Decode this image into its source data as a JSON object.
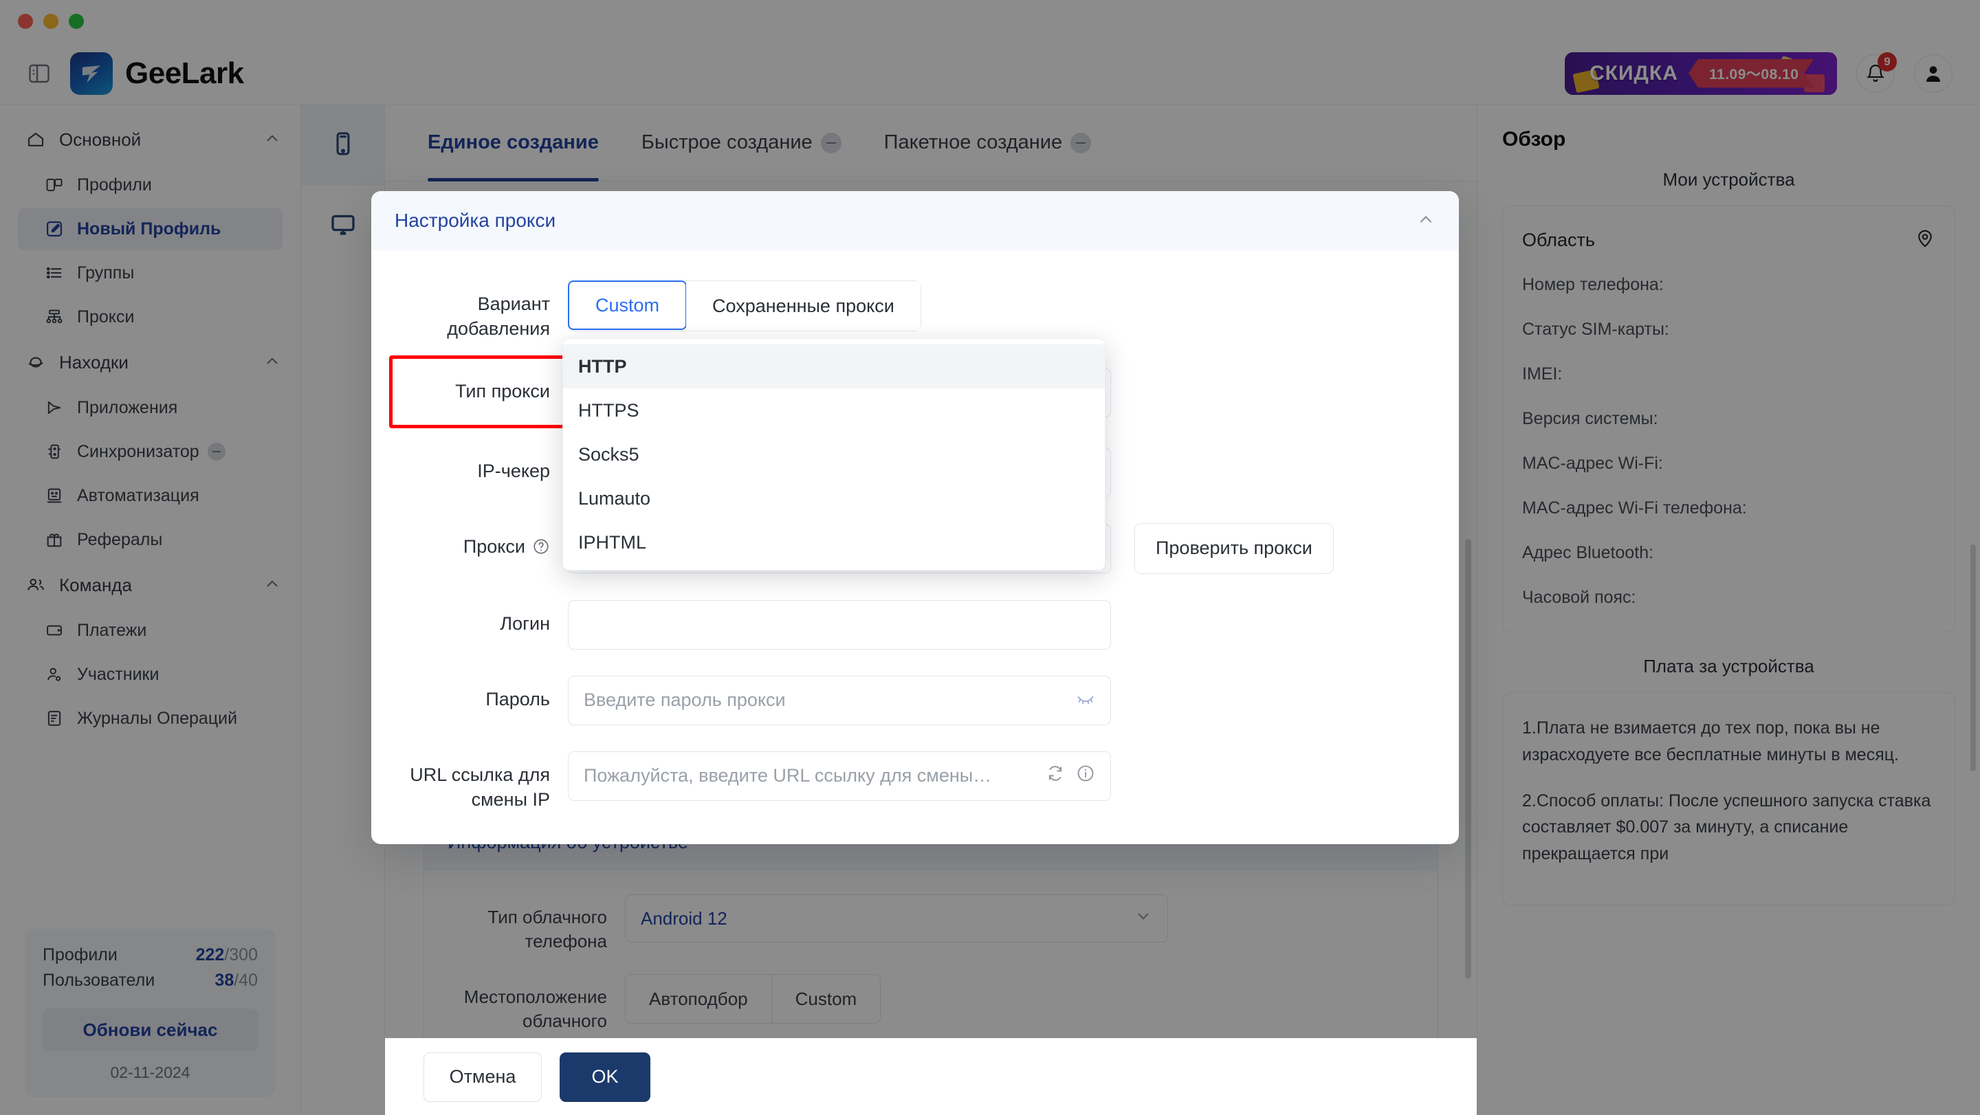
{
  "window": {
    "traffic_lights": [
      "close",
      "minimize",
      "maximize"
    ]
  },
  "header": {
    "brand_name": "GeeLark",
    "panel_toggle_icon": "panel-toggle-icon",
    "promo": {
      "word": "СКИДКА",
      "dates": "11.09～08.10"
    },
    "notifications_badge": "9",
    "bell_icon": "bell-icon",
    "avatar_icon": "avatar-icon"
  },
  "sidebar": {
    "groups": [
      {
        "label": "Основной",
        "icon": "home-icon",
        "items": [
          {
            "label": "Профили",
            "icon": "profiles-icon",
            "active": false
          },
          {
            "label": "Новый Профиль",
            "icon": "new-profile-icon",
            "active": true
          },
          {
            "label": "Группы",
            "icon": "groups-icon",
            "active": false
          },
          {
            "label": "Прокси",
            "icon": "proxy-icon",
            "active": false
          }
        ]
      },
      {
        "label": "Находки",
        "icon": "discover-icon",
        "items": [
          {
            "label": "Приложения",
            "icon": "apps-icon",
            "active": false
          },
          {
            "label": "Синхронизатор",
            "icon": "sync-icon",
            "active": false,
            "muted_tag": true
          },
          {
            "label": "Автоматизация",
            "icon": "automation-icon",
            "active": false
          },
          {
            "label": "Рефералы",
            "icon": "referrals-icon",
            "active": false
          }
        ]
      },
      {
        "label": "Команда",
        "icon": "team-icon",
        "items": [
          {
            "label": "Платежи",
            "icon": "payments-icon",
            "active": false
          },
          {
            "label": "Участники",
            "icon": "members-icon",
            "active": false
          },
          {
            "label": "Журналы Операций",
            "icon": "logs-icon",
            "active": false
          }
        ]
      }
    ],
    "stats": [
      {
        "label": "Профили",
        "used": "222",
        "total": "/300"
      },
      {
        "label": "Пользователи",
        "used": "38",
        "total": "/40"
      }
    ],
    "upgrade_label": "Обнови сейчас",
    "date": "02-11-2024"
  },
  "rail": {
    "items": [
      {
        "icon": "phone-icon",
        "active": true
      },
      {
        "icon": "monitor-icon",
        "active": false
      }
    ]
  },
  "main": {
    "tabs": [
      {
        "label": "Единое создание",
        "active": true,
        "has_pill": false
      },
      {
        "label": "Быстрое создание",
        "active": false,
        "has_pill": true
      },
      {
        "label": "Пакетное создание",
        "active": false,
        "has_pill": true
      }
    ],
    "device_section": {
      "title": "Информация об устройстве",
      "collapse_icon": "chevron-up-icon",
      "rows": [
        {
          "label": "Тип облачного телефона",
          "type": "select",
          "value": "Android 12"
        },
        {
          "label": "Местоположение облачного",
          "type": "segment",
          "options": [
            "Автоподбор",
            "Custom"
          ],
          "selected": "Автоподбор"
        }
      ]
    }
  },
  "modal": {
    "title": "Настройка прокси",
    "collapse_icon": "chevron-up-icon",
    "rows": {
      "add_variant": {
        "label": "Вариант добавления",
        "options": [
          "Custom",
          "Сохраненные прокси"
        ],
        "selected": "Custom"
      },
      "proxy_type": {
        "label": "Тип прокси",
        "value": "HTTP",
        "highlighted": true,
        "options": [
          "HTTP",
          "HTTPS",
          "Socks5",
          "Lumauto",
          "IPHTML"
        ],
        "selected_option": "HTTP"
      },
      "ip_checker": {
        "label": "IP-чекер"
      },
      "proxy": {
        "label": "Прокси",
        "help_icon": "help-circle-icon",
        "check_button": "Проверить прокси"
      },
      "login": {
        "label": "Логин"
      },
      "password": {
        "label": "Пароль",
        "placeholder": "Введите пароль прокси",
        "eye_icon": "eye-off-icon"
      },
      "ip_change_url": {
        "label": "URL ссылка для смены IP",
        "placeholder": "Пожалуйста, введите URL ссылку для смены IP...",
        "refresh_icon": "refresh-icon",
        "info_icon": "info-circle-icon"
      }
    }
  },
  "footer": {
    "cancel_label": "Отмена",
    "ok_label": "OK"
  },
  "right_panel": {
    "title": "Обзор",
    "devices_heading": "Мои устройства",
    "region_label": "Область",
    "location_icon": "location-pin-icon",
    "fields": [
      "Номер телефона:",
      "Статус SIM-карты:",
      "IMEI:",
      "Версия системы:",
      "MAC-адрес Wi-Fi:",
      "MAC-адрес Wi-Fi телефона:",
      "Адрес Bluetooth:",
      "Часовой пояс:"
    ],
    "billing_heading": "Плата за устройства",
    "billing_items": [
      "1.Плата не взимается до тех пор, пока вы не израсходуете все бесплатные минуты в месяц.",
      "2.Способ оплаты: После успешного запуска ставка составляет $0.007 за минуту, а списание прекращается при"
    ]
  }
}
